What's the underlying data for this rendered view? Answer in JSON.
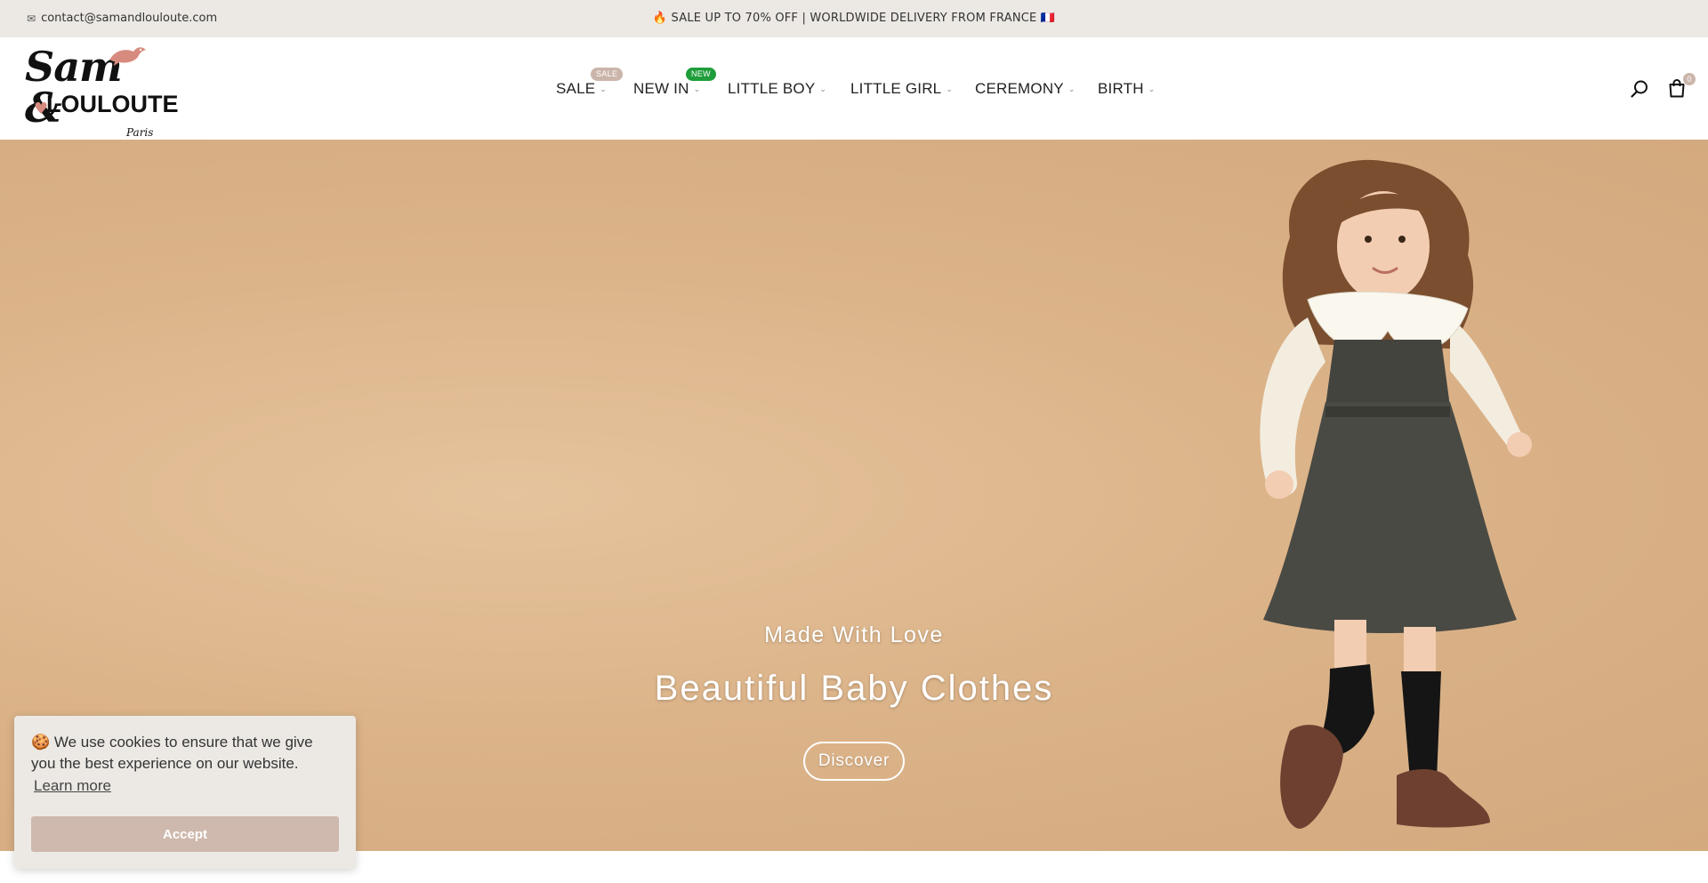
{
  "topbar": {
    "mail_icon": "mail-icon",
    "email": "contact@samandlouloute.com",
    "announcement": "🔥 SALE UP TO 70% OFF | WORLDWIDE DELIVERY FROM FRANCE 🇫🇷"
  },
  "logo": {
    "line1": "Sam &",
    "line2": "LOULOUTE",
    "line3": "Paris"
  },
  "nav": {
    "items": [
      {
        "label": "SALE",
        "badge": "SALE"
      },
      {
        "label": "NEW IN",
        "badge": "NEW"
      },
      {
        "label": "LITTLE BOY"
      },
      {
        "label": "LITTLE GIRL"
      },
      {
        "label": "CEREMONY"
      },
      {
        "label": "BIRTH"
      }
    ],
    "chevron": "⌄"
  },
  "header_icons": {
    "search": "search-icon",
    "cart": "shopping-bag-icon",
    "cart_count": "0"
  },
  "hero": {
    "subtitle": "Made With Love",
    "title": "Beautiful Baby Clothes",
    "button": "Discover"
  },
  "cookie": {
    "message": "🍪 We use cookies to ensure that we give you the best experience on our website.",
    "learn_more": "Learn more",
    "accept": "Accept"
  },
  "colors": {
    "topbar_bg": "#ece9e5",
    "hero_bg": "#dcb48a",
    "sale_badge": "#cbb5aa",
    "new_badge": "#1f9d3b",
    "accept_button": "#cfb8ad"
  }
}
